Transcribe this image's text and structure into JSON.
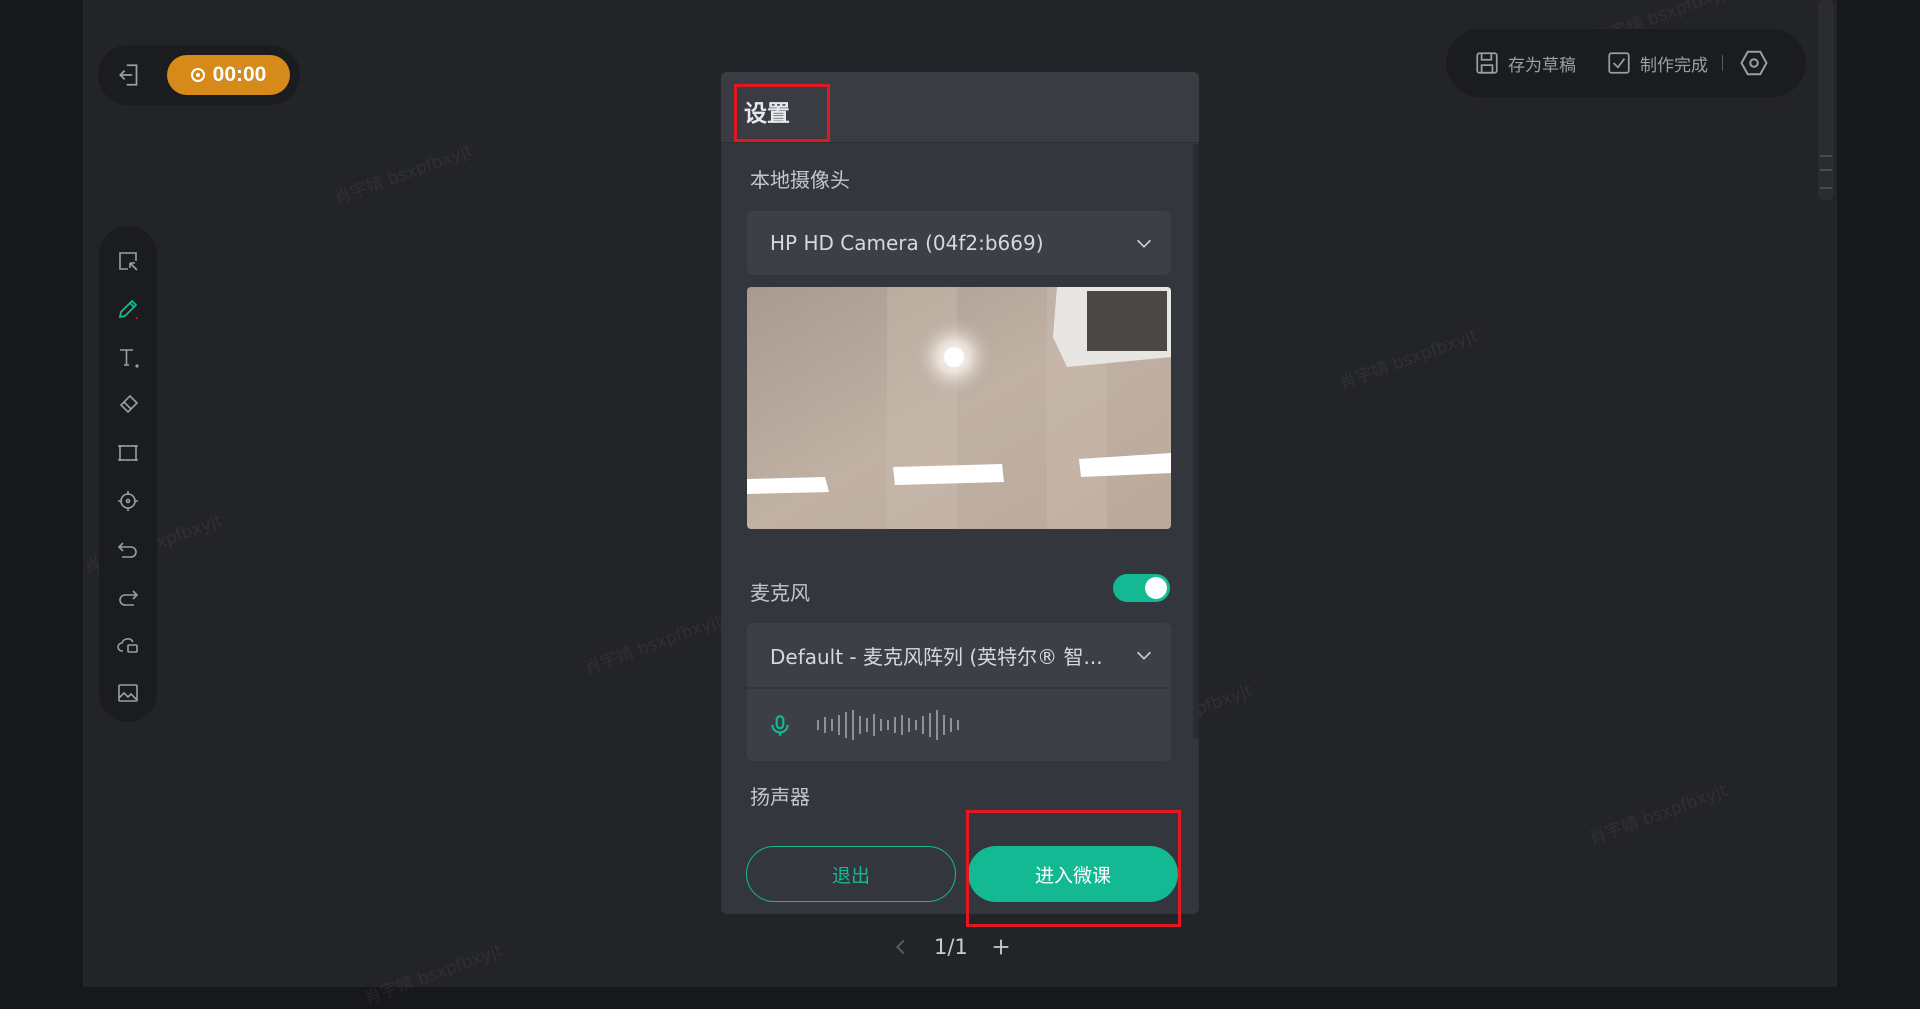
{
  "timer": {
    "value": "00:00",
    "color": "#d58a1a"
  },
  "top_actions": {
    "save_draft": "存为草稿",
    "finish": "制作完成"
  },
  "toolbar": {
    "tools": [
      "select-icon",
      "pen-icon",
      "text-icon",
      "eraser-icon",
      "rectangle-icon",
      "laser-pointer-icon",
      "undo-icon",
      "redo-icon",
      "cloud-icon",
      "image-icon"
    ],
    "active": "pen-icon"
  },
  "modal": {
    "title": "设置",
    "camera": {
      "label": "本地摄像头",
      "selected": "HP HD Camera (04f2:b669)"
    },
    "microphone": {
      "label": "麦克风",
      "enabled": true,
      "selected": "Default - 麦克风阵列 (英特尔® 智..."
    },
    "speaker": {
      "label": "扬声器"
    },
    "buttons": {
      "exit": "退出",
      "enter": "进入微课"
    }
  },
  "pager": {
    "text": "1/1"
  },
  "watermark": "肖宇婧 bsxpfbxyjt",
  "colors": {
    "accent": "#13b993",
    "highlight": "#e3171f"
  }
}
